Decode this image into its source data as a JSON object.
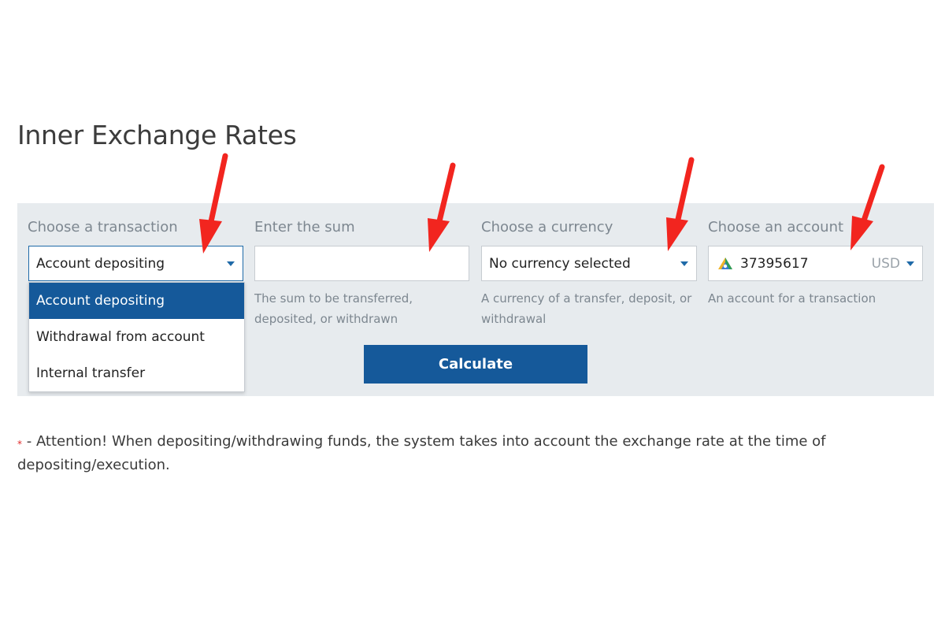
{
  "page_title": "Inner Exchange Rates",
  "transaction": {
    "label": "Choose a transaction",
    "value": "Account depositing",
    "options": [
      "Account depositing",
      "Withdrawal from account",
      "Internal transfer"
    ]
  },
  "sum": {
    "label": "Enter the sum",
    "value": "",
    "help": "The sum to be transferred, deposited, or withdrawn"
  },
  "currency": {
    "label": "Choose a currency",
    "value": "No currency selected",
    "help": "A currency of a transfer, deposit, or withdrawal"
  },
  "account": {
    "label": "Choose an account",
    "number": "37395617",
    "currency": "USD",
    "help": "An account for a transaction",
    "icon": "account-logo-icon"
  },
  "calculate_label": "Calculate",
  "note": {
    "star": "*",
    "text": " - Attention! When depositing/withdrawing funds, the system takes into account the exchange rate at the time of depositing/execution."
  },
  "colors": {
    "accent": "#15599a",
    "panel": "#e7ebee",
    "annotation_arrow": "#f2251f"
  }
}
